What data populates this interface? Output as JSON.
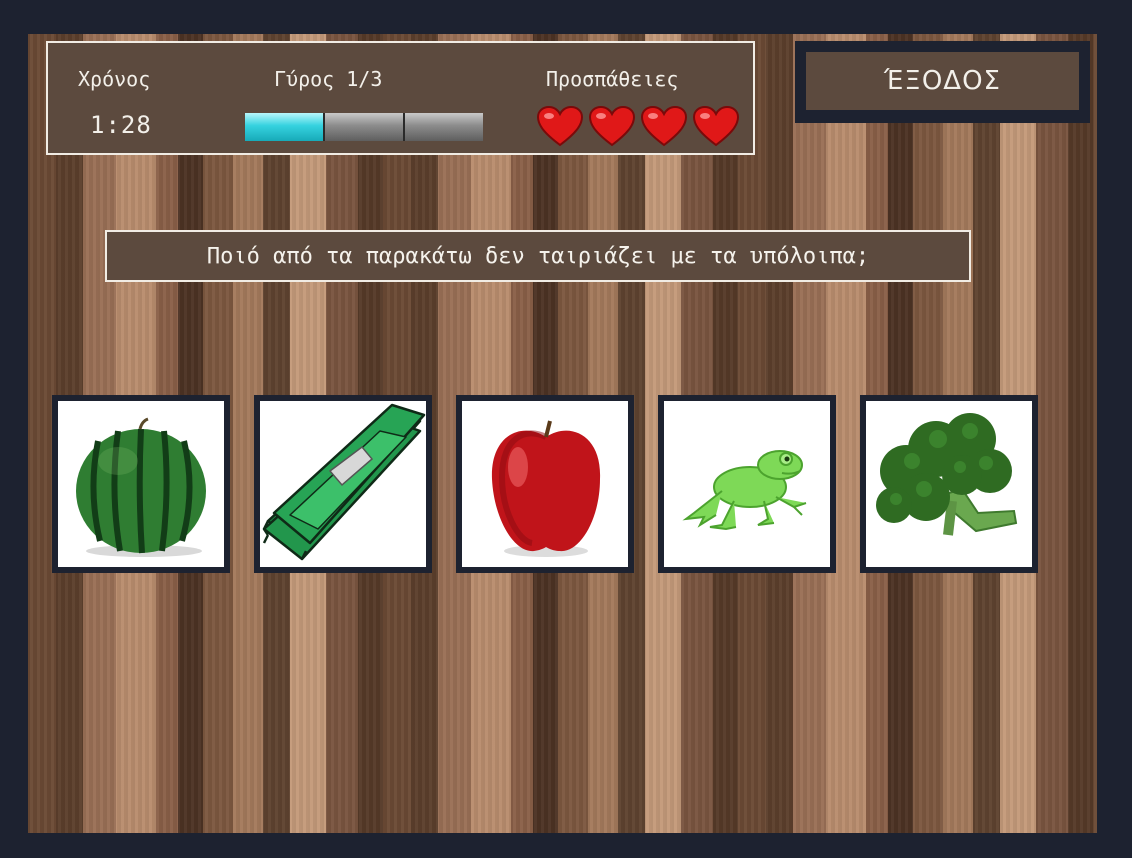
{
  "hud": {
    "time_label": "Χρόνος",
    "time_value": "1:28",
    "round_label": "Γύρος 1/3",
    "round_current": 1,
    "round_total": 3,
    "attempts_label": "Προσπάθειες",
    "attempts_remaining": 4
  },
  "exit_button": {
    "label": "ΈΞΟΔΟΣ"
  },
  "question": {
    "text": "Ποιό από τα παρακάτω δεν ταιριάζει με τα υπόλοιπα;"
  },
  "choices": [
    {
      "icon": "watermelon-icon"
    },
    {
      "icon": "money-stack-icon"
    },
    {
      "icon": "apple-icon"
    },
    {
      "icon": "frog-icon"
    },
    {
      "icon": "broccoli-icon"
    }
  ],
  "colors": {
    "panel": "#5c4a3e",
    "frame": "#1d2230",
    "progress_fill": "#35d2df",
    "heart": "#e01818"
  }
}
